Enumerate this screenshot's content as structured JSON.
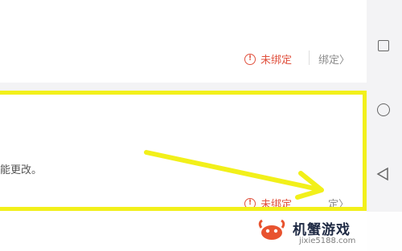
{
  "top_row": {
    "status": "未绑定",
    "action": "绑定〉"
  },
  "bottom_row": {
    "description": "能更改。",
    "status": "未绑定",
    "action": "定〉"
  },
  "watermark": {
    "title": "机蟹游戏",
    "url": "jixie5188.com"
  },
  "colors": {
    "status_red": "#e0513e",
    "highlight_yellow": "#f2f01a"
  },
  "icons": [
    "warning-circle-icon",
    "square-nav-icon",
    "circle-nav-icon",
    "back-triangle-icon"
  ]
}
